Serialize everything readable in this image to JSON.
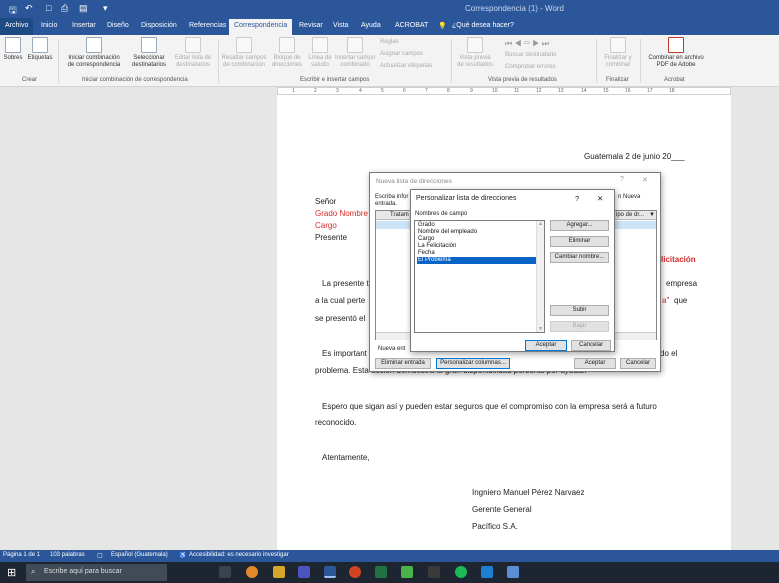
{
  "titlebar": {
    "doc_title": "Correspondencia (1) - Word"
  },
  "tabs": [
    "Archivo",
    "Inicio",
    "Insertar",
    "Diseño",
    "Disposición",
    "Referencias",
    "Correspondencia",
    "Revisar",
    "Vista",
    "Ayuda",
    "ACROBAT"
  ],
  "tell_me": "¿Qué desea hacer?",
  "ribbon": {
    "sobres": "Sobres",
    "etiquetas": "Etiquetas",
    "iniciar_1": "Iniciar combinación",
    "iniciar_2": "de correspondencia",
    "selec_1": "Seleccionar",
    "selec_2": "destinatarios",
    "editar_1": "Editar lista de",
    "editar_2": "destinatarios",
    "resaltar_1": "Resaltar campos",
    "resaltar_2": "de combinación",
    "bloque_1": "Bloque de",
    "bloque_2": "direcciones",
    "linea_1": "Línea de",
    "linea_2": "saludo",
    "insertar_1": "Insertar campo",
    "insertar_2": "combinado",
    "reglas": "Reglas",
    "asignar": "Asignar campos",
    "actualizar": "Actualizar etiquetas",
    "vista_1": "Vista previa",
    "vista_2": "de resultados",
    "buscar": "Buscar destinatario",
    "comprobar": "Comprobar errores",
    "finalizar_1": "Finalizar y",
    "finalizar_2": "combinar",
    "combinar_pdf_1": "Combinar en archivo",
    "combinar_pdf_2": "PDF de Adobe",
    "groups": {
      "crear": "Crear",
      "iniciar": "Iniciar combinación de correspondencia",
      "escribir": "Escribir e insertar campos",
      "vista": "Vista previa de resultados",
      "finalizar": "Finalizar",
      "acrobat": "Acrobat"
    }
  },
  "ruler": [
    "1",
    "2",
    "3",
    "4",
    "5",
    "6",
    "7",
    "8",
    "9",
    "10",
    "11",
    "12",
    "13",
    "14",
    "15",
    "16",
    "17",
    "18"
  ],
  "document": {
    "date": "Guatemala 2 de junio 20___",
    "senor": "Señor",
    "grado_nombre": "Grado Nombre",
    "cargo": "Cargo",
    "presente": "Presente",
    "felicitacion": "licitación",
    "p1_start": "La presente t",
    "p1_end": "empresa",
    "p2_start": "a la cual perte",
    "p2_red": "a\"",
    "p2_end": "que",
    "p3_start": "se presentó el",
    "p4_start": "Es important",
    "p4_end": "do el",
    "p5": "problema. Esta acción demuestra la gran disponibilidad personal por ayudar.",
    "p6": "Espero que sigan así y pueden estar seguros que el compromiso con la empresa será a futuro",
    "p7": "reconocido.",
    "atentamente": "Atentamente,",
    "sig_name": "Ingniero Manuel Pérez Narvaez",
    "sig_title": "Gerente General",
    "sig_company": "Pacífico S.A."
  },
  "dlg_back": {
    "title": "Nueva lista de direcciones",
    "desc_1": "Escriba infor",
    "desc_2": "entrada.",
    "col_tratamiento": "Tratam",
    "col_right": "ipo de dr...",
    "new_right": "n Nueva",
    "nueva_entrada": "Nueva ent",
    "eliminar": "Eliminar entrada",
    "personalizar": "Personalizar columnas...",
    "aceptar": "Aceptar",
    "cancelar": "Cancelar"
  },
  "dlg_front": {
    "title": "Personalizar lista de direcciones",
    "help": "?",
    "close": "✕",
    "label": "Nombres de campo",
    "fields": [
      "Grado",
      "Nombre del empleado",
      "Cargo",
      "La Felicitación",
      "Fecha",
      "El Problema"
    ],
    "selected_index": 5,
    "agregar": "Agregar...",
    "eliminar": "Eliminar",
    "cambiar": "Cambiar nombre...",
    "subir": "Subir",
    "bajar": "Bajar",
    "aceptar": "Aceptar",
    "cancelar": "Cancelar"
  },
  "statusbar": {
    "page": "Página 1 de 1",
    "words": "103 palabras",
    "language": "Español (Guatemala)",
    "accessibility": "Accesibilidad: es necesario investigar"
  },
  "taskbar": {
    "search_placeholder": "Escribe aquí para buscar"
  }
}
